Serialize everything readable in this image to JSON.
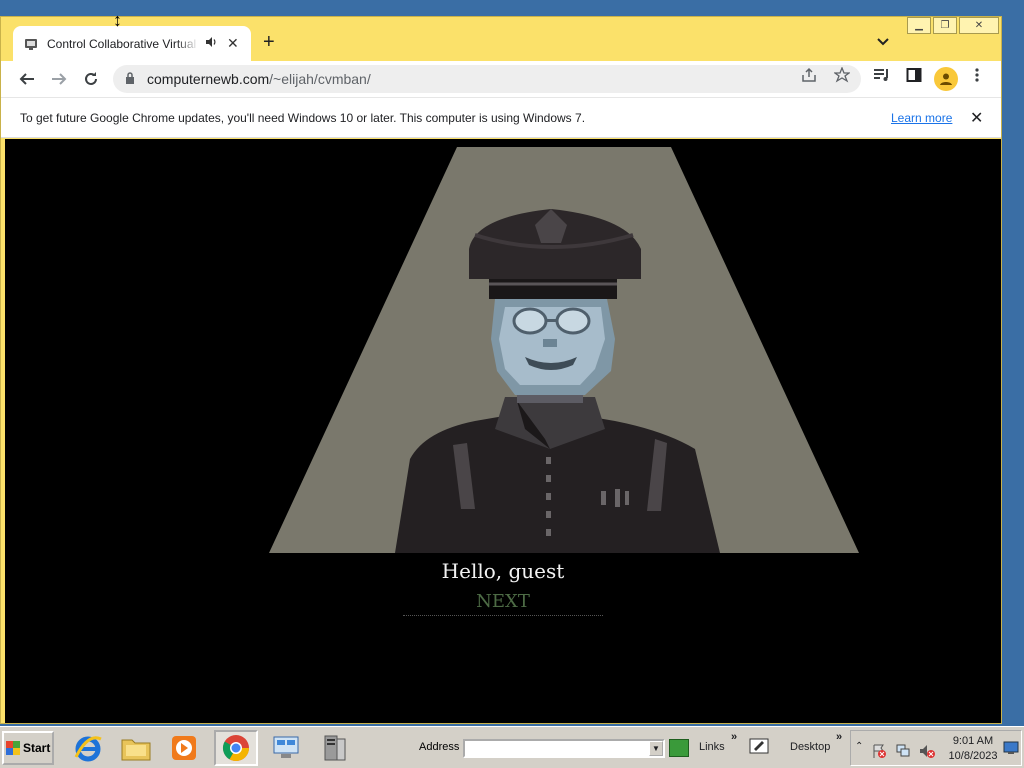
{
  "browser": {
    "tab": {
      "title": "Control Collaborative Virtual Machine",
      "audio_icon": "speaker-icon",
      "close_icon": "close-icon"
    },
    "new_tab_icon": "plus-icon",
    "tab_search_icon": "chevron-down-icon",
    "window_controls": [
      "minimize",
      "maximize",
      "close"
    ],
    "toolbar": {
      "url_host": "computernewb.com",
      "url_path": "/~elijah/cvmban/",
      "icons": [
        "back-icon",
        "forward-icon",
        "reload-icon",
        "lock-icon",
        "share-icon",
        "star-icon",
        "media-icon",
        "sidepanel-icon",
        "profile-icon",
        "menu-icon"
      ]
    },
    "infobar": {
      "message": "To get future Google Chrome updates, you'll need Windows 10 or later. This computer is using Windows 7.",
      "link": "Learn more"
    }
  },
  "page": {
    "greeting": "Hello, guest",
    "next_button": "NEXT"
  },
  "taskbar": {
    "start_label": "Start",
    "address_label": "Address",
    "address_value": "",
    "links_label": "Links",
    "desktop_label": "Desktop",
    "clock_time": "9:01 AM",
    "clock_date": "10/8/2023",
    "quick_launch": [
      "internet-explorer-icon",
      "file-explorer-icon",
      "media-player-icon",
      "chrome-icon",
      "network-icon",
      "server-icon"
    ]
  },
  "colors": {
    "titlebar": "#fbe16a",
    "spotlight": "#7a786c",
    "next_text": "#4d6b45",
    "accent_link": "#1a73e8"
  }
}
